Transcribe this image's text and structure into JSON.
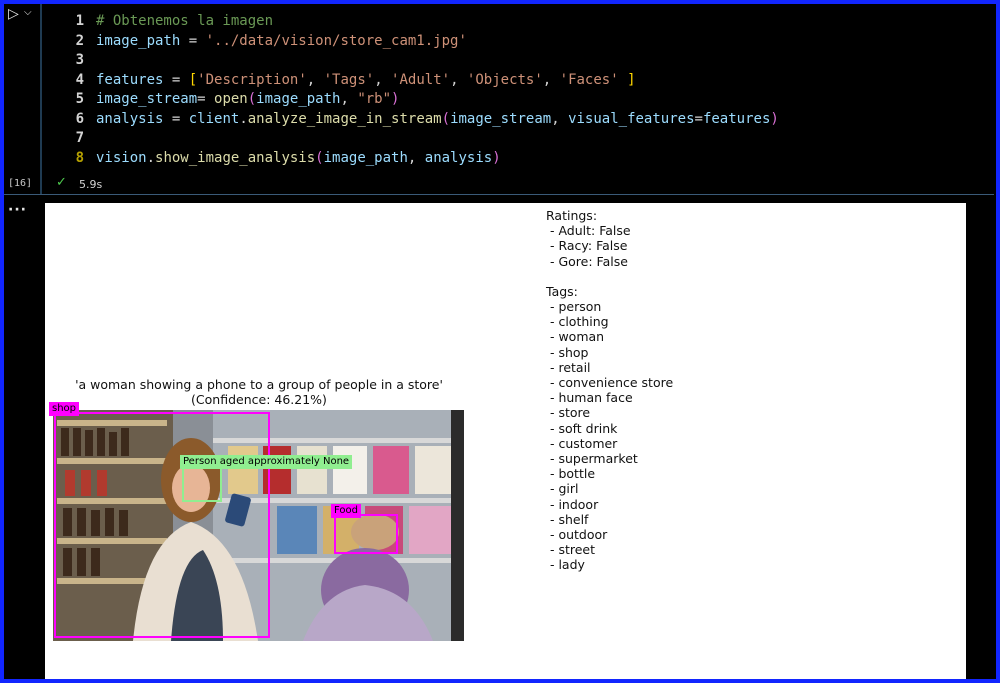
{
  "cell": {
    "exec_count": "[16]",
    "time": "5.9s",
    "lines": [
      {
        "n": "1",
        "segs": [
          {
            "t": "# Obtenemos la imagen",
            "c": "c-com"
          }
        ]
      },
      {
        "n": "2",
        "segs": [
          {
            "t": "image_path",
            "c": "c-var"
          },
          {
            "t": " = ",
            "c": "c-op"
          },
          {
            "t": "'../data/vision/store_cam1.jpg'",
            "c": "c-str"
          }
        ]
      },
      {
        "n": "3",
        "segs": []
      },
      {
        "n": "4",
        "segs": [
          {
            "t": "features",
            "c": "c-var"
          },
          {
            "t": " = ",
            "c": "c-op"
          },
          {
            "t": "[",
            "c": "c-br"
          },
          {
            "t": "'Description'",
            "c": "c-str"
          },
          {
            "t": ", ",
            "c": "c-op"
          },
          {
            "t": "'Tags'",
            "c": "c-str"
          },
          {
            "t": ", ",
            "c": "c-op"
          },
          {
            "t": "'Adult'",
            "c": "c-str"
          },
          {
            "t": ", ",
            "c": "c-op"
          },
          {
            "t": "'Objects'",
            "c": "c-str"
          },
          {
            "t": ", ",
            "c": "c-op"
          },
          {
            "t": "'Faces'",
            "c": "c-str"
          },
          {
            "t": " ]",
            "c": "c-br"
          }
        ]
      },
      {
        "n": "5",
        "segs": [
          {
            "t": "image_stream",
            "c": "c-var"
          },
          {
            "t": "= ",
            "c": "c-op"
          },
          {
            "t": "open",
            "c": "c-fn"
          },
          {
            "t": "(",
            "c": "c-br2"
          },
          {
            "t": "image_path",
            "c": "c-var"
          },
          {
            "t": ", ",
            "c": "c-op"
          },
          {
            "t": "\"rb\"",
            "c": "c-str"
          },
          {
            "t": ")",
            "c": "c-br2"
          }
        ]
      },
      {
        "n": "6",
        "segs": [
          {
            "t": "analysis",
            "c": "c-var"
          },
          {
            "t": " = ",
            "c": "c-op"
          },
          {
            "t": "client",
            "c": "c-var"
          },
          {
            "t": ".",
            "c": "c-op"
          },
          {
            "t": "analyze_image_in_stream",
            "c": "c-fn"
          },
          {
            "t": "(",
            "c": "c-br2"
          },
          {
            "t": "image_stream",
            "c": "c-var"
          },
          {
            "t": ", ",
            "c": "c-op"
          },
          {
            "t": "visual_features",
            "c": "c-var"
          },
          {
            "t": "=",
            "c": "c-op"
          },
          {
            "t": "features",
            "c": "c-var"
          },
          {
            "t": ")",
            "c": "c-br2"
          }
        ]
      },
      {
        "n": "7",
        "segs": []
      },
      {
        "n": "8",
        "segs": [
          {
            "t": "vision",
            "c": "c-var"
          },
          {
            "t": ".",
            "c": "c-op"
          },
          {
            "t": "show_image_analysis",
            "c": "c-fn"
          },
          {
            "t": "(",
            "c": "c-br2"
          },
          {
            "t": "image_path",
            "c": "c-var"
          },
          {
            "t": ", ",
            "c": "c-op"
          },
          {
            "t": "analysis",
            "c": "c-var"
          },
          {
            "t": ")",
            "c": "c-br2"
          }
        ]
      }
    ]
  },
  "output": {
    "caption_line1": "'a woman showing a phone to a group of people in a store'",
    "caption_line2": "(Confidence: 46.21%)",
    "labels": {
      "shop": "shop",
      "person": "Person aged approximately None",
      "food": "Food"
    },
    "ratings_header": "Ratings:",
    "ratings": [
      " - Adult: False",
      " - Racy: False",
      " - Gore: False"
    ],
    "tags_header": "Tags:",
    "tags": [
      " - person",
      " - clothing",
      " - woman",
      " - shop",
      " - retail",
      " - convenience store",
      " - human face",
      " - store",
      " - soft drink",
      " - customer",
      " - supermarket",
      " - bottle",
      " - girl",
      " - indoor",
      " - shelf",
      " - outdoor",
      " - street",
      " - lady"
    ]
  },
  "colors": {
    "frame": "#1226ff",
    "shop_box": "#ff00ff",
    "face_box": "#90ee90"
  }
}
